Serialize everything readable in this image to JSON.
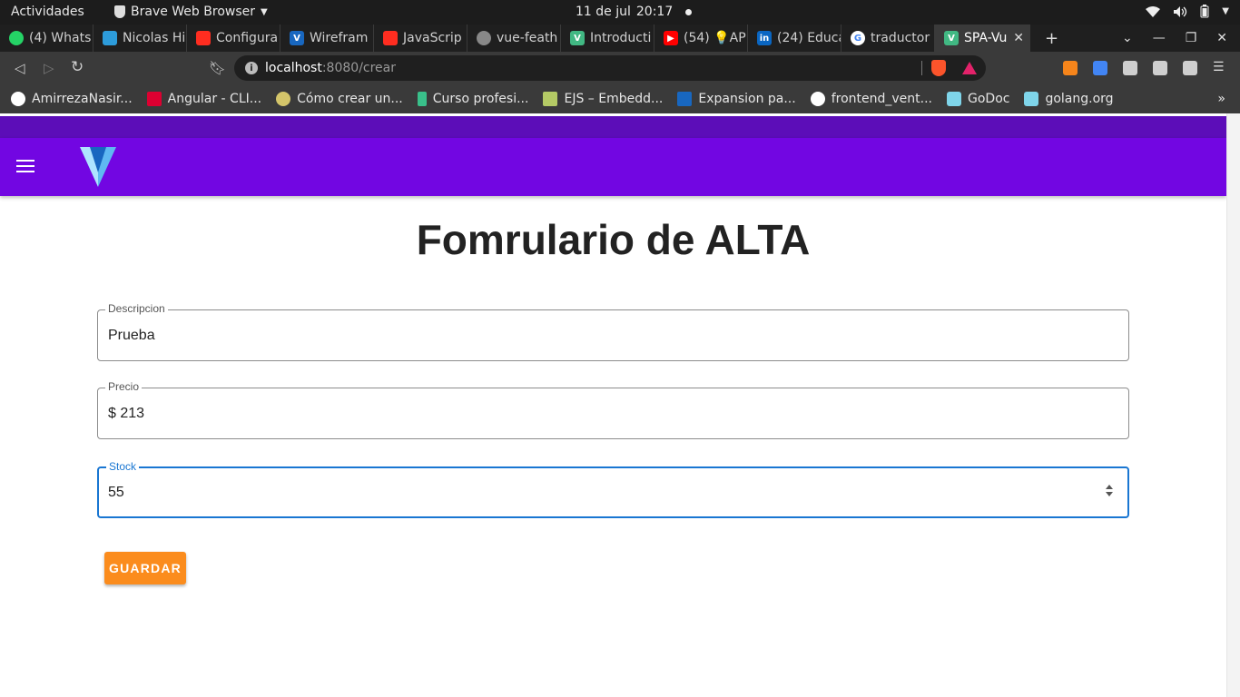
{
  "system": {
    "activities": "Actividades",
    "app_name": "Brave Web Browser",
    "date": "11 de jul",
    "time": "20:17"
  },
  "tabs": [
    {
      "title": "(4) Whats",
      "icon": "whatsapp-icon",
      "color": "#25d366"
    },
    {
      "title": "Nicolas Hi",
      "icon": "trello-wave-icon",
      "color": "#2d9cdb"
    },
    {
      "title": "Configura",
      "icon": "laravel-icon",
      "color": "#ff2d20"
    },
    {
      "title": "Wirefram",
      "icon": "vuetify-icon",
      "color": "#1867c0"
    },
    {
      "title": "JavaScrip",
      "icon": "laravel-icon",
      "color": "#ff2d20"
    },
    {
      "title": "vue-feath",
      "icon": "globe-icon",
      "color": "#888888"
    },
    {
      "title": "Introducti",
      "icon": "vue-icon",
      "color": "#41b883"
    },
    {
      "title": "(54) 💡AP",
      "icon": "youtube-icon",
      "color": "#ff0000"
    },
    {
      "title": "(24) Educa",
      "icon": "linkedin-icon",
      "color": "#0a66c2"
    },
    {
      "title": "traductor",
      "icon": "google-icon",
      "color": "#4285f4"
    },
    {
      "title": "SPA-Vu",
      "icon": "vue-icon",
      "color": "#41b883",
      "active": true
    }
  ],
  "address": {
    "host": "localhost",
    "path": ":8080/crear"
  },
  "bookmarks": [
    {
      "label": "AmirrezaNasir...",
      "icon": "github-icon",
      "color": "#ffffff"
    },
    {
      "label": "Angular - CLI...",
      "icon": "angular-icon",
      "color": "#dd0031"
    },
    {
      "label": "Cómo crear un...",
      "icon": "bulb-icon",
      "color": "#d4c56a"
    },
    {
      "label": "Curso profesi...",
      "icon": "course-icon",
      "color": "#39c08a"
    },
    {
      "label": "EJS – Embedd...",
      "icon": "ejs-icon",
      "color": "#b4ca65"
    },
    {
      "label": "Expansion pa...",
      "icon": "vuetify-icon",
      "color": "#1867c0"
    },
    {
      "label": "frontend_vent...",
      "icon": "github-icon",
      "color": "#ffffff"
    },
    {
      "label": "GoDoc",
      "icon": "gopher-icon",
      "color": "#7fd5ea"
    },
    {
      "label": "golang.org",
      "icon": "gopher-icon",
      "color": "#7fd5ea"
    }
  ],
  "bookmarks_more": "»",
  "page": {
    "title": "Fomrulario de ALTA",
    "fields": {
      "descripcion": {
        "label": "Descripcion",
        "value": "Prueba"
      },
      "precio": {
        "label": "Precio",
        "value": "$ 213"
      },
      "stock": {
        "label": "Stock",
        "value": "55"
      }
    },
    "save_label": "GUARDAR"
  },
  "colors": {
    "appbar": "#7206e2",
    "appbar_top": "#5c0db8",
    "button": "#fb8c1d",
    "focus": "#1976d2"
  }
}
